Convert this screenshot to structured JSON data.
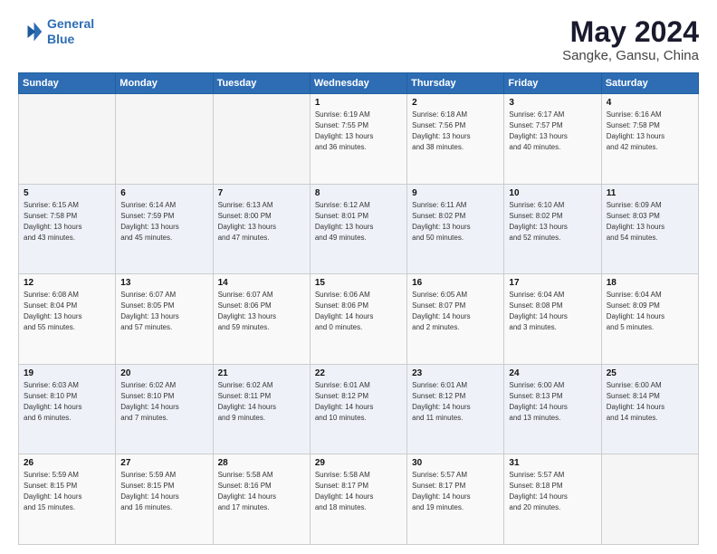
{
  "logo": {
    "line1": "General",
    "line2": "Blue"
  },
  "title": "May 2024",
  "subtitle": "Sangke, Gansu, China",
  "days_header": [
    "Sunday",
    "Monday",
    "Tuesday",
    "Wednesday",
    "Thursday",
    "Friday",
    "Saturday"
  ],
  "weeks": [
    [
      {
        "day": "",
        "info": ""
      },
      {
        "day": "",
        "info": ""
      },
      {
        "day": "",
        "info": ""
      },
      {
        "day": "1",
        "info": "Sunrise: 6:19 AM\nSunset: 7:55 PM\nDaylight: 13 hours\nand 36 minutes."
      },
      {
        "day": "2",
        "info": "Sunrise: 6:18 AM\nSunset: 7:56 PM\nDaylight: 13 hours\nand 38 minutes."
      },
      {
        "day": "3",
        "info": "Sunrise: 6:17 AM\nSunset: 7:57 PM\nDaylight: 13 hours\nand 40 minutes."
      },
      {
        "day": "4",
        "info": "Sunrise: 6:16 AM\nSunset: 7:58 PM\nDaylight: 13 hours\nand 42 minutes."
      }
    ],
    [
      {
        "day": "5",
        "info": "Sunrise: 6:15 AM\nSunset: 7:58 PM\nDaylight: 13 hours\nand 43 minutes."
      },
      {
        "day": "6",
        "info": "Sunrise: 6:14 AM\nSunset: 7:59 PM\nDaylight: 13 hours\nand 45 minutes."
      },
      {
        "day": "7",
        "info": "Sunrise: 6:13 AM\nSunset: 8:00 PM\nDaylight: 13 hours\nand 47 minutes."
      },
      {
        "day": "8",
        "info": "Sunrise: 6:12 AM\nSunset: 8:01 PM\nDaylight: 13 hours\nand 49 minutes."
      },
      {
        "day": "9",
        "info": "Sunrise: 6:11 AM\nSunset: 8:02 PM\nDaylight: 13 hours\nand 50 minutes."
      },
      {
        "day": "10",
        "info": "Sunrise: 6:10 AM\nSunset: 8:02 PM\nDaylight: 13 hours\nand 52 minutes."
      },
      {
        "day": "11",
        "info": "Sunrise: 6:09 AM\nSunset: 8:03 PM\nDaylight: 13 hours\nand 54 minutes."
      }
    ],
    [
      {
        "day": "12",
        "info": "Sunrise: 6:08 AM\nSunset: 8:04 PM\nDaylight: 13 hours\nand 55 minutes."
      },
      {
        "day": "13",
        "info": "Sunrise: 6:07 AM\nSunset: 8:05 PM\nDaylight: 13 hours\nand 57 minutes."
      },
      {
        "day": "14",
        "info": "Sunrise: 6:07 AM\nSunset: 8:06 PM\nDaylight: 13 hours\nand 59 minutes."
      },
      {
        "day": "15",
        "info": "Sunrise: 6:06 AM\nSunset: 8:06 PM\nDaylight: 14 hours\nand 0 minutes."
      },
      {
        "day": "16",
        "info": "Sunrise: 6:05 AM\nSunset: 8:07 PM\nDaylight: 14 hours\nand 2 minutes."
      },
      {
        "day": "17",
        "info": "Sunrise: 6:04 AM\nSunset: 8:08 PM\nDaylight: 14 hours\nand 3 minutes."
      },
      {
        "day": "18",
        "info": "Sunrise: 6:04 AM\nSunset: 8:09 PM\nDaylight: 14 hours\nand 5 minutes."
      }
    ],
    [
      {
        "day": "19",
        "info": "Sunrise: 6:03 AM\nSunset: 8:10 PM\nDaylight: 14 hours\nand 6 minutes."
      },
      {
        "day": "20",
        "info": "Sunrise: 6:02 AM\nSunset: 8:10 PM\nDaylight: 14 hours\nand 7 minutes."
      },
      {
        "day": "21",
        "info": "Sunrise: 6:02 AM\nSunset: 8:11 PM\nDaylight: 14 hours\nand 9 minutes."
      },
      {
        "day": "22",
        "info": "Sunrise: 6:01 AM\nSunset: 8:12 PM\nDaylight: 14 hours\nand 10 minutes."
      },
      {
        "day": "23",
        "info": "Sunrise: 6:01 AM\nSunset: 8:12 PM\nDaylight: 14 hours\nand 11 minutes."
      },
      {
        "day": "24",
        "info": "Sunrise: 6:00 AM\nSunset: 8:13 PM\nDaylight: 14 hours\nand 13 minutes."
      },
      {
        "day": "25",
        "info": "Sunrise: 6:00 AM\nSunset: 8:14 PM\nDaylight: 14 hours\nand 14 minutes."
      }
    ],
    [
      {
        "day": "26",
        "info": "Sunrise: 5:59 AM\nSunset: 8:15 PM\nDaylight: 14 hours\nand 15 minutes."
      },
      {
        "day": "27",
        "info": "Sunrise: 5:59 AM\nSunset: 8:15 PM\nDaylight: 14 hours\nand 16 minutes."
      },
      {
        "day": "28",
        "info": "Sunrise: 5:58 AM\nSunset: 8:16 PM\nDaylight: 14 hours\nand 17 minutes."
      },
      {
        "day": "29",
        "info": "Sunrise: 5:58 AM\nSunset: 8:17 PM\nDaylight: 14 hours\nand 18 minutes."
      },
      {
        "day": "30",
        "info": "Sunrise: 5:57 AM\nSunset: 8:17 PM\nDaylight: 14 hours\nand 19 minutes."
      },
      {
        "day": "31",
        "info": "Sunrise: 5:57 AM\nSunset: 8:18 PM\nDaylight: 14 hours\nand 20 minutes."
      },
      {
        "day": "",
        "info": ""
      }
    ]
  ]
}
